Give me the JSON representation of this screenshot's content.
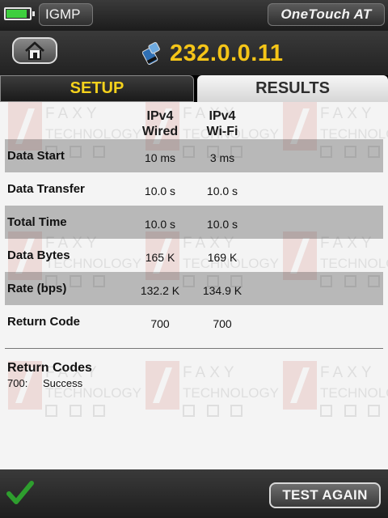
{
  "status": {
    "battery_level": 0.9,
    "battery_color": "#3ecf3e",
    "mode_label": "IGMP",
    "brand": "OneTouch AT"
  },
  "header": {
    "address": "232.0.0.11",
    "address_color": "#f5c518",
    "address_icon": "multicast-group-icon",
    "home_icon": "home-icon"
  },
  "tabs": [
    {
      "label": "SETUP",
      "active": true
    },
    {
      "label": "RESULTS",
      "active": false
    }
  ],
  "table": {
    "columns": [
      {
        "line1": "IPv4",
        "line2": "Wired"
      },
      {
        "line1": "IPv4",
        "line2": "Wi-Fi"
      }
    ],
    "rows": [
      {
        "label": "Data Start",
        "wired": "10 ms",
        "wifi": "3 ms"
      },
      {
        "label": "Data Transfer",
        "wired": "10.0 s",
        "wifi": "10.0 s"
      },
      {
        "label": "Total Time",
        "wired": "10.0 s",
        "wifi": "10.0 s"
      },
      {
        "label": "Data Bytes",
        "wired": "165 K",
        "wifi": "169 K"
      },
      {
        "label": "Rate (bps)",
        "wired": "132.2 K",
        "wifi": "134.9 K"
      },
      {
        "label": "Return Code",
        "wired": "700",
        "wifi": "700"
      }
    ]
  },
  "return_codes": {
    "title": "Return Codes",
    "items": [
      {
        "code": "700:",
        "text": "Success"
      }
    ]
  },
  "watermark": {
    "line1": "FAXY",
    "line2": "TECHNOLOGY"
  },
  "footer": {
    "status_icon": "checkmark-icon",
    "status_color": "#2e9e2e",
    "button_label": "TEST AGAIN"
  }
}
